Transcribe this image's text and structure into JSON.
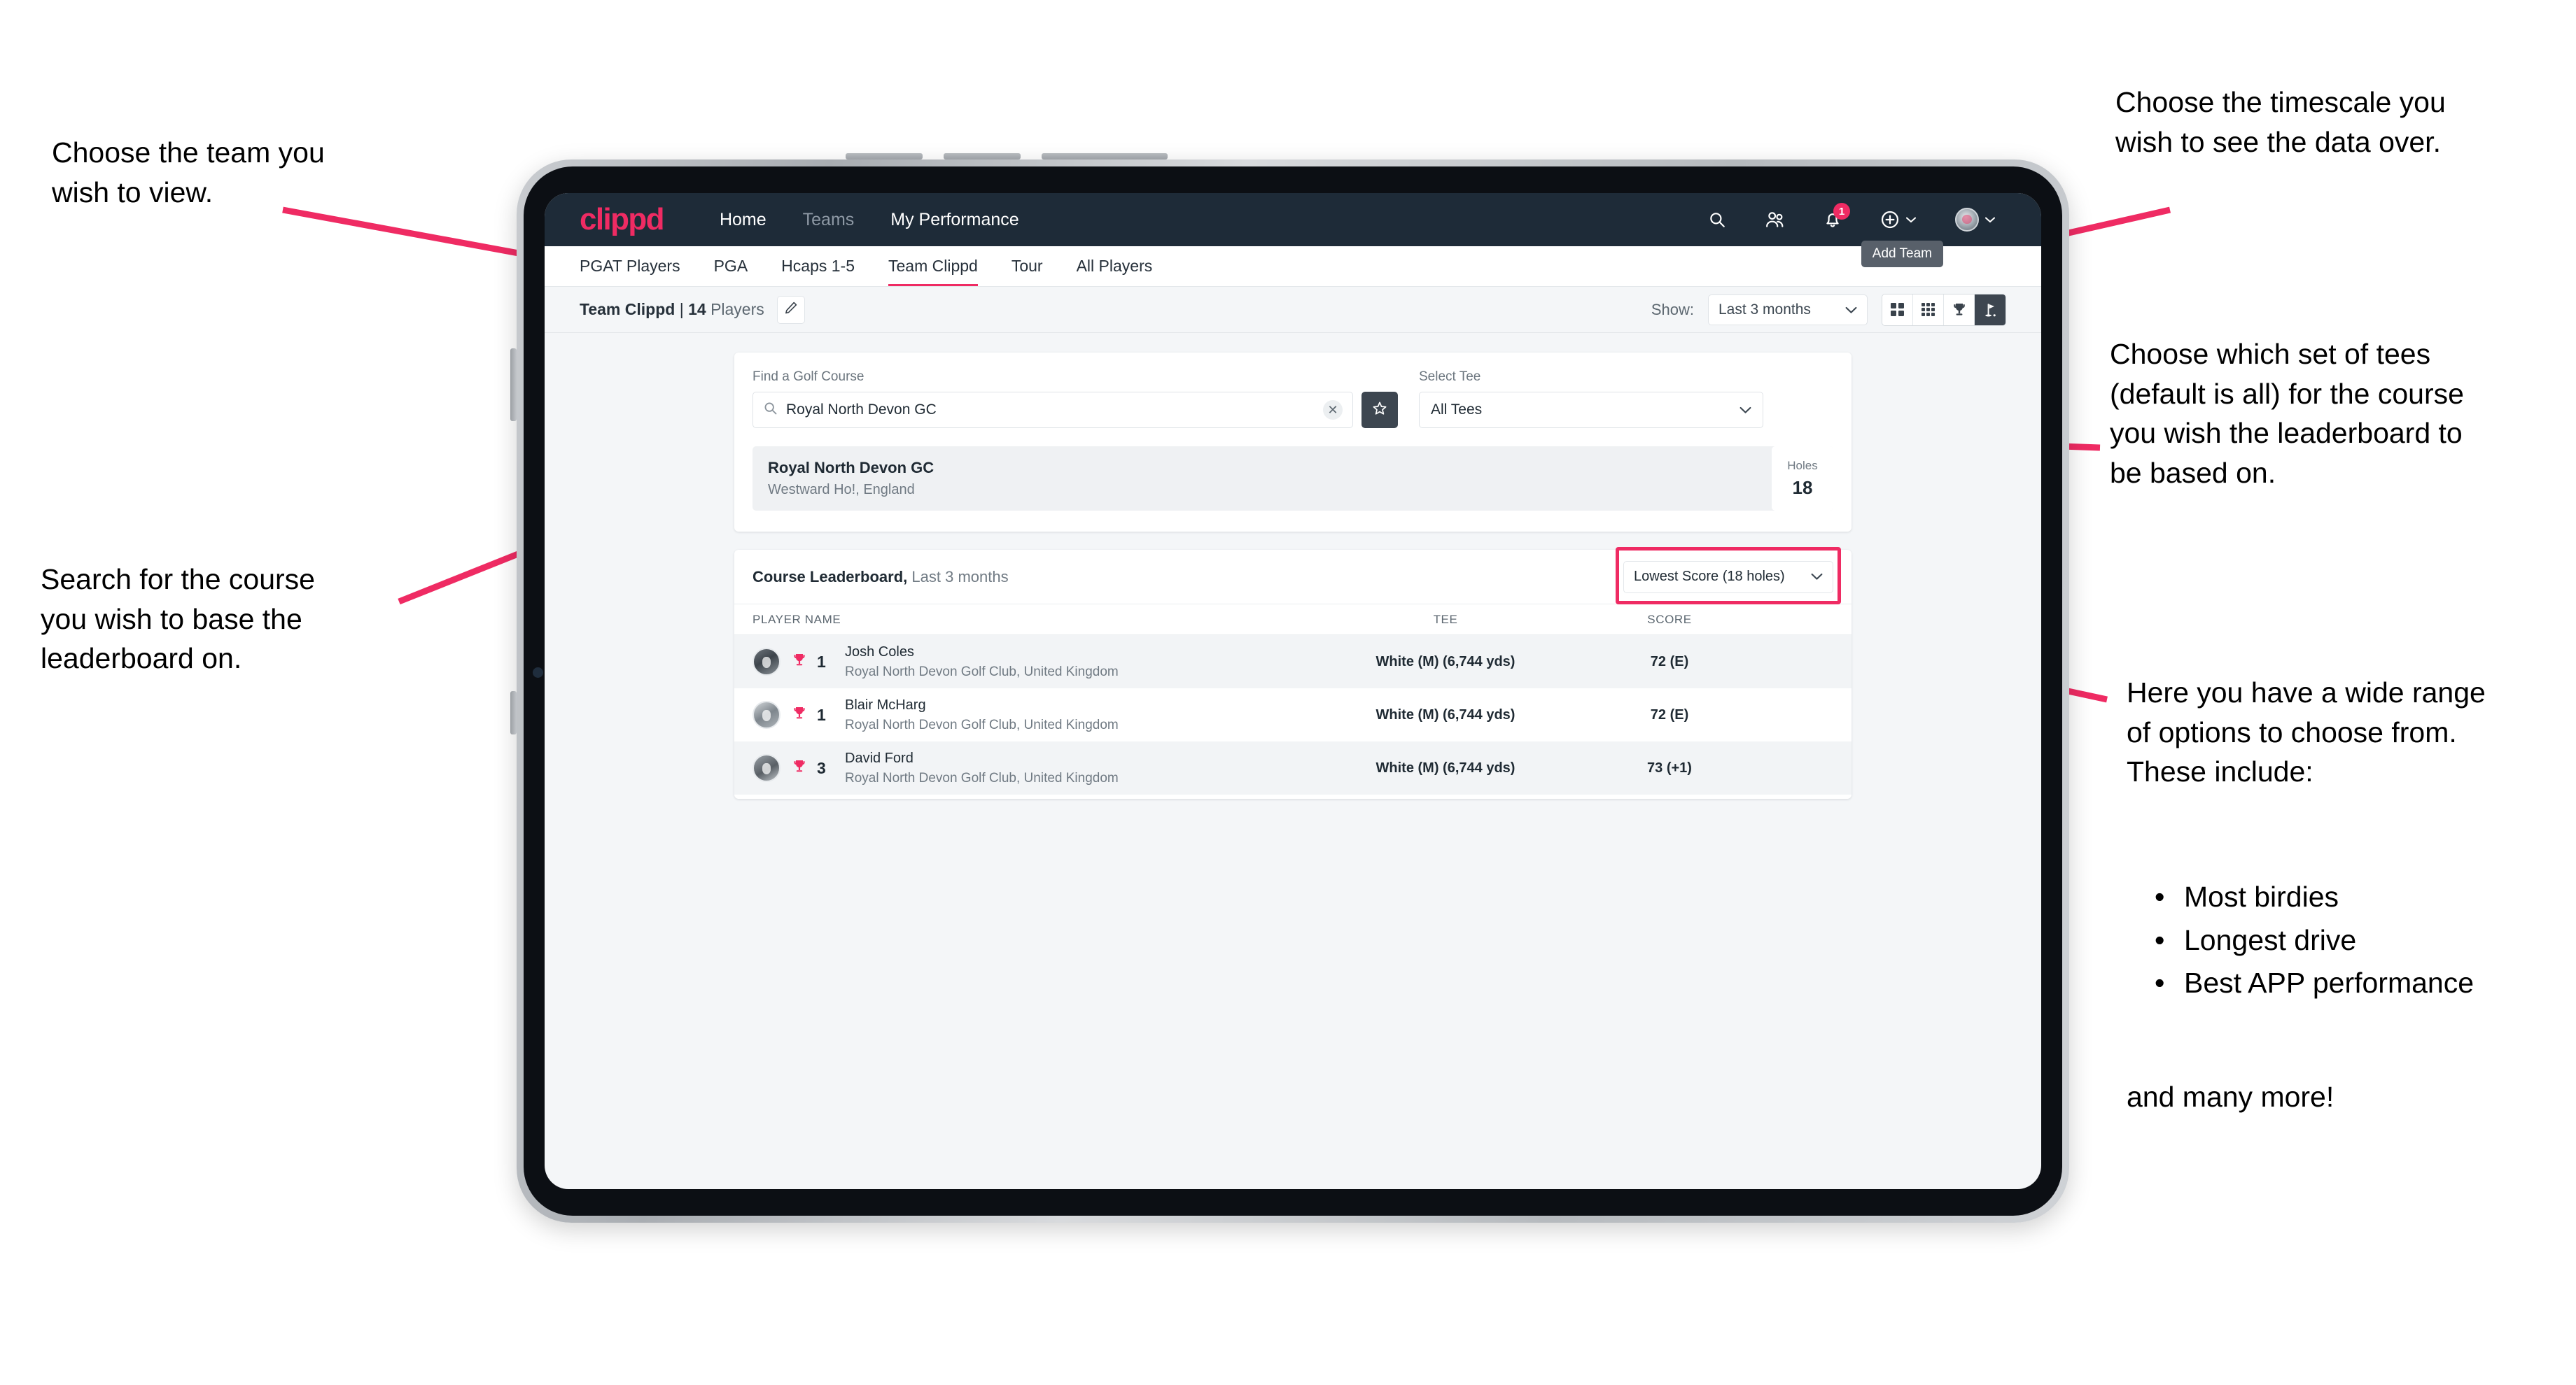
{
  "annotations": {
    "team": "Choose the team you\nwish to view.",
    "search": "Search for the course\nyou wish to base the\nleaderboard on.",
    "timescale": "Choose the timescale you\nwish to see the data over.",
    "tees": "Choose which set of tees\n(default is all) for the course\nyou wish the leaderboard to\nbe based on.",
    "options_intro": "Here you have a wide range\nof options to choose from.\nThese include:",
    "options_bullets": [
      "Most birdies",
      "Longest drive",
      "Best APP performance"
    ],
    "options_outro": "and many more!"
  },
  "navbar": {
    "logo": "clippd",
    "links": [
      {
        "label": "Home",
        "dim": false
      },
      {
        "label": "Teams",
        "dim": true
      },
      {
        "label": "My Performance",
        "dim": false
      }
    ],
    "icons": [
      "search-icon",
      "people-icon",
      "bell-icon",
      "plus-circle-icon",
      "avatar-icon"
    ],
    "notification_count": "1",
    "tooltip": "Add Team"
  },
  "tabs": [
    {
      "label": "PGAT Players",
      "active": false,
      "dim": false
    },
    {
      "label": "PGA",
      "active": false,
      "dim": false
    },
    {
      "label": "Hcaps 1-5",
      "active": false,
      "dim": false
    },
    {
      "label": "Team Clippd",
      "active": true,
      "dim": true
    },
    {
      "label": "Tour",
      "active": false,
      "dim": false
    },
    {
      "label": "All Players",
      "active": false,
      "dim": false
    }
  ],
  "toolbar": {
    "team_name": "Team Clippd",
    "separator": " | ",
    "player_count": "14",
    "players_word": "Players",
    "edit_icon": "pencil-icon",
    "show_label": "Show:",
    "show_value": "Last 3 months",
    "view_buttons": [
      "grid-4-icon",
      "grid-9-icon",
      "trophy-icon",
      "golf-flag-icon"
    ],
    "active_view": "golf-flag-icon"
  },
  "search": {
    "course_label": "Find a Golf Course",
    "course_value": "Royal North Devon GC",
    "course_placeholder": "Find a Golf Course",
    "clear_icon": "close-icon",
    "favourite_icon": "star-icon",
    "tee_label": "Select Tee",
    "tee_value": "All Tees"
  },
  "course_result": {
    "name": "Royal North Devon GC",
    "location": "Westward Ho!, England",
    "holes_label": "Holes",
    "holes_value": "18"
  },
  "leaderboard": {
    "title": "Course Leaderboard,",
    "subtitle": "Last 3 months",
    "metric": "Lowest Score (18 holes)",
    "columns": [
      "PLAYER NAME",
      "TEE",
      "SCORE"
    ],
    "rows": [
      {
        "rank": "1",
        "name": "Josh Coles",
        "club": "Royal North Devon Golf Club, United Kingdom",
        "tee": "White (M) (6,744 yds)",
        "score": "72 (E)"
      },
      {
        "rank": "1",
        "name": "Blair McHarg",
        "club": "Royal North Devon Golf Club, United Kingdom",
        "tee": "White (M) (6,744 yds)",
        "score": "72 (E)"
      },
      {
        "rank": "3",
        "name": "David Ford",
        "club": "Royal North Devon Golf Club, United Kingdom",
        "tee": "White (M) (6,744 yds)",
        "score": "73 (+1)"
      }
    ]
  },
  "colors": {
    "accent_pink": "#ef2b63",
    "nav_dark": "#1e2b38",
    "page_bg": "#f4f6f8",
    "toggle_active": "#3d4650"
  }
}
